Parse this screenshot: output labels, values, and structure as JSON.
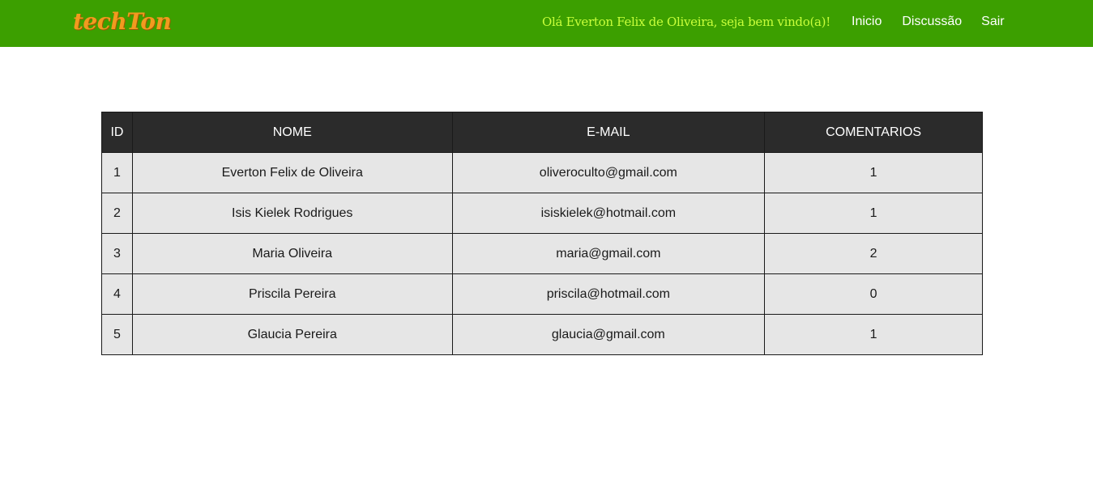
{
  "header": {
    "logo": "techTon",
    "greeting": "Olá Everton Felix de Oliveira, seja bem vindo(a)!",
    "nav": [
      {
        "label": "Inicio"
      },
      {
        "label": "Discussão"
      },
      {
        "label": "Sair"
      }
    ],
    "colors": {
      "bar": "#3c9f00",
      "logo": "#f29a1f",
      "greeting": "#c8ff3a"
    }
  },
  "table": {
    "columns": [
      "ID",
      "NOME",
      "E-MAIL",
      "COMENTARIOS"
    ],
    "rows": [
      {
        "id": "1",
        "nome": "Everton Felix de Oliveira",
        "email": "oliveroculto@gmail.com",
        "comentarios": "1"
      },
      {
        "id": "2",
        "nome": "Isis Kielek Rodrigues",
        "email": "isiskielek@hotmail.com",
        "comentarios": "1"
      },
      {
        "id": "3",
        "nome": "Maria Oliveira",
        "email": "maria@gmail.com",
        "comentarios": "2"
      },
      {
        "id": "4",
        "nome": "Priscila Pereira",
        "email": "priscila@hotmail.com",
        "comentarios": "0"
      },
      {
        "id": "5",
        "nome": "Glaucia Pereira",
        "email": "glaucia@gmail.com",
        "comentarios": "1"
      }
    ]
  }
}
